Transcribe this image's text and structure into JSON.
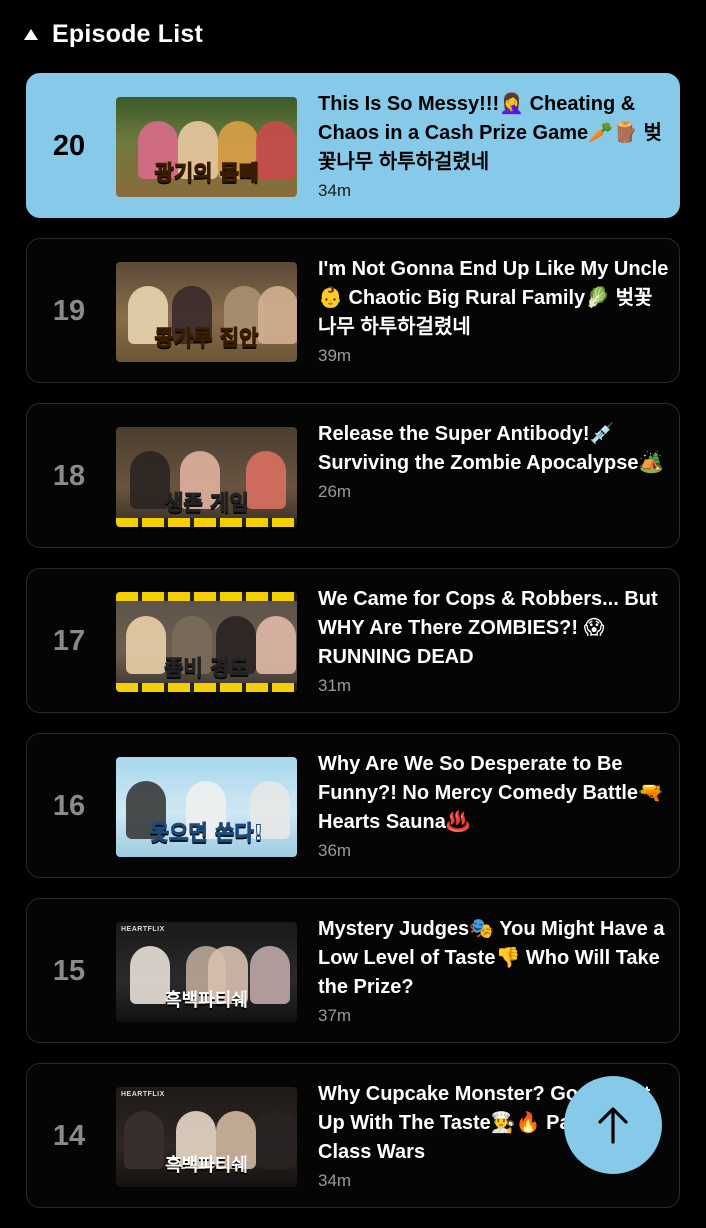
{
  "header": {
    "title": "Episode List",
    "collapse_icon": "caret-up-icon"
  },
  "episodes": [
    {
      "number": "20",
      "title": "This Is So Messy!!!🤦‍♀️ Cheating & Chaos in a Cash Prize Game🥕🪵 벚꽃나무 하투하걸렸네",
      "duration": "34m",
      "thumb_caption": "광기의 몸빼",
      "active": true
    },
    {
      "number": "19",
      "title": "I'm Not Gonna End Up Like My Uncle👶 Chaotic Big Rural Family🥬 벚꽃나무 하투하걸렸네",
      "duration": "39m",
      "thumb_caption": "콩가루 집안",
      "active": false
    },
    {
      "number": "18",
      "title": "Release the Super Antibody!💉 Surviving the Zombie Apocalypse🏕️",
      "duration": "26m",
      "thumb_caption": "생존 게임",
      "active": false
    },
    {
      "number": "17",
      "title": "We Came for Cops & Robbers... But WHY Are There ZOMBIES?! 😱 RUNNING DEAD",
      "duration": "31m",
      "thumb_caption": "좀비 경도",
      "active": false
    },
    {
      "number": "16",
      "title": "Why Are We So Desperate to Be Funny?! No Mercy Comedy Battle🔫 Hearts Sauna♨️",
      "duration": "36m",
      "thumb_caption": "웃으면 쏜다!",
      "active": false
    },
    {
      "number": "15",
      "title": "Mystery Judges🎭 You Might Have a Low Level of Taste👎 Who Will Take the Prize?",
      "duration": "37m",
      "thumb_caption": "흑백파티쉐",
      "thumb_brand": "HEARTFLIX",
      "active": false
    },
    {
      "number": "14",
      "title": "Why Cupcake Monster? Go Whip It Up With The Taste👨‍🍳🔥 Patisserie Class Wars",
      "duration": "34m",
      "thumb_caption": "흑백파티쉐",
      "thumb_brand": "HEARTFLIX",
      "active": false
    }
  ],
  "scroll_top_button": {
    "icon": "arrow-up-icon"
  },
  "colors": {
    "accent": "#86c9e8",
    "background": "#000000",
    "caption": "#ffd84a"
  }
}
